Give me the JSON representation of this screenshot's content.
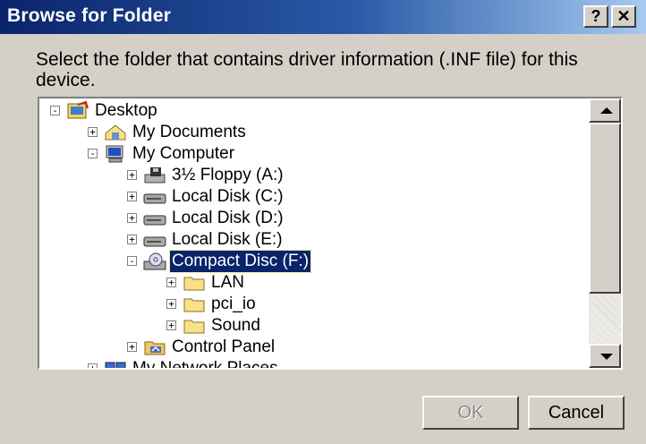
{
  "dialog": {
    "title": "Browse for Folder",
    "help_button": "?",
    "close_button": "✕",
    "instruction": "Select the folder that contains driver information (.INF file) for this device."
  },
  "tree": {
    "items": [
      {
        "label": "Desktop",
        "icon": "desktop-icon",
        "expander": "-"
      },
      {
        "label": "My Documents",
        "icon": "my-documents-icon",
        "expander": "+"
      },
      {
        "label": "My Computer",
        "icon": "my-computer-icon",
        "expander": "-"
      },
      {
        "label": "3½ Floppy (A:)",
        "icon": "floppy-drive-icon",
        "expander": "+"
      },
      {
        "label": "Local Disk (C:)",
        "icon": "hard-drive-icon",
        "expander": "+"
      },
      {
        "label": "Local Disk (D:)",
        "icon": "hard-drive-icon",
        "expander": "+"
      },
      {
        "label": "Local Disk (E:)",
        "icon": "hard-drive-icon",
        "expander": "+"
      },
      {
        "label": "Compact Disc (F:)",
        "icon": "cd-drive-icon",
        "expander": "-",
        "selected": true
      },
      {
        "label": "LAN",
        "icon": "folder-icon",
        "expander": "+"
      },
      {
        "label": "pci_io",
        "icon": "folder-icon",
        "expander": "+"
      },
      {
        "label": "Sound",
        "icon": "folder-icon",
        "expander": "+"
      },
      {
        "label": "Control Panel",
        "icon": "control-panel-icon",
        "expander": "+"
      },
      {
        "label": "My Network Places",
        "icon": "network-places-icon",
        "expander": "+"
      }
    ]
  },
  "buttons": {
    "ok": "OK",
    "cancel": "Cancel"
  },
  "colors": {
    "title_bar_start": "#0a246a",
    "title_bar_end": "#a6caf0",
    "selection": "#0a246a",
    "dialog_face": "#d4d0c8"
  }
}
